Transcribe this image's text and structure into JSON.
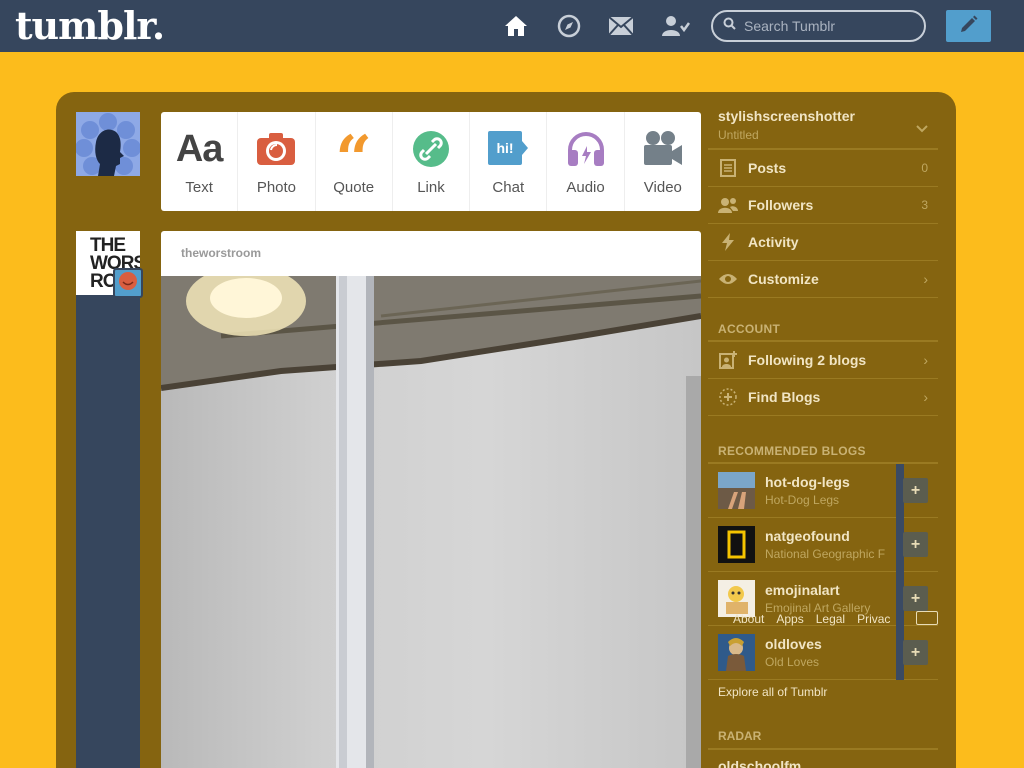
{
  "header": {
    "logo": "tumblr.",
    "search_placeholder": "Search Tumblr",
    "colors": {
      "bar": "#36465d",
      "accent": "#529ecc",
      "background": "#fcbc1c"
    }
  },
  "post_types": [
    {
      "label": "Text",
      "icon": "text-icon",
      "color": "#444444"
    },
    {
      "label": "Photo",
      "icon": "camera-icon",
      "color": "#d95e40"
    },
    {
      "label": "Quote",
      "icon": "quote-icon",
      "color": "#f2992e"
    },
    {
      "label": "Link",
      "icon": "link-icon",
      "color": "#56bc8a"
    },
    {
      "label": "Chat",
      "icon": "chat-icon",
      "color": "#529ecc"
    },
    {
      "label": "Audio",
      "icon": "headphones-icon",
      "color": "#a77dc2"
    },
    {
      "label": "Video",
      "icon": "video-camera-icon",
      "color": "#748089"
    }
  ],
  "post": {
    "blog_name": "theworstroom",
    "avatar_text": "THE WORST ROO"
  },
  "sidebar": {
    "blog_name": "stylishscreenshotter",
    "blog_title": "Untitled",
    "items": [
      {
        "label": "Posts",
        "count": "0"
      },
      {
        "label": "Followers",
        "count": "3"
      },
      {
        "label": "Activity"
      },
      {
        "label": "Customize"
      }
    ],
    "account_heading": "ACCOUNT",
    "account_items": [
      {
        "label": "Following 2 blogs"
      },
      {
        "label": "Find Blogs"
      }
    ],
    "recommended_heading": "RECOMMENDED BLOGS",
    "recommended": [
      {
        "name": "hot-dog-legs",
        "desc": "Hot-Dog Legs"
      },
      {
        "name": "natgeofound",
        "desc": "National Geographic F"
      },
      {
        "name": "emojinalart",
        "desc": "Emojinal Art Gallery"
      },
      {
        "name": "oldloves",
        "desc": "Old Loves"
      }
    ],
    "footer_links": [
      "About",
      "Apps",
      "Legal",
      "Privac"
    ],
    "explore": "Explore all of Tumblr",
    "radar_heading": "RADAR",
    "radar_item": "oldschoolfm"
  }
}
